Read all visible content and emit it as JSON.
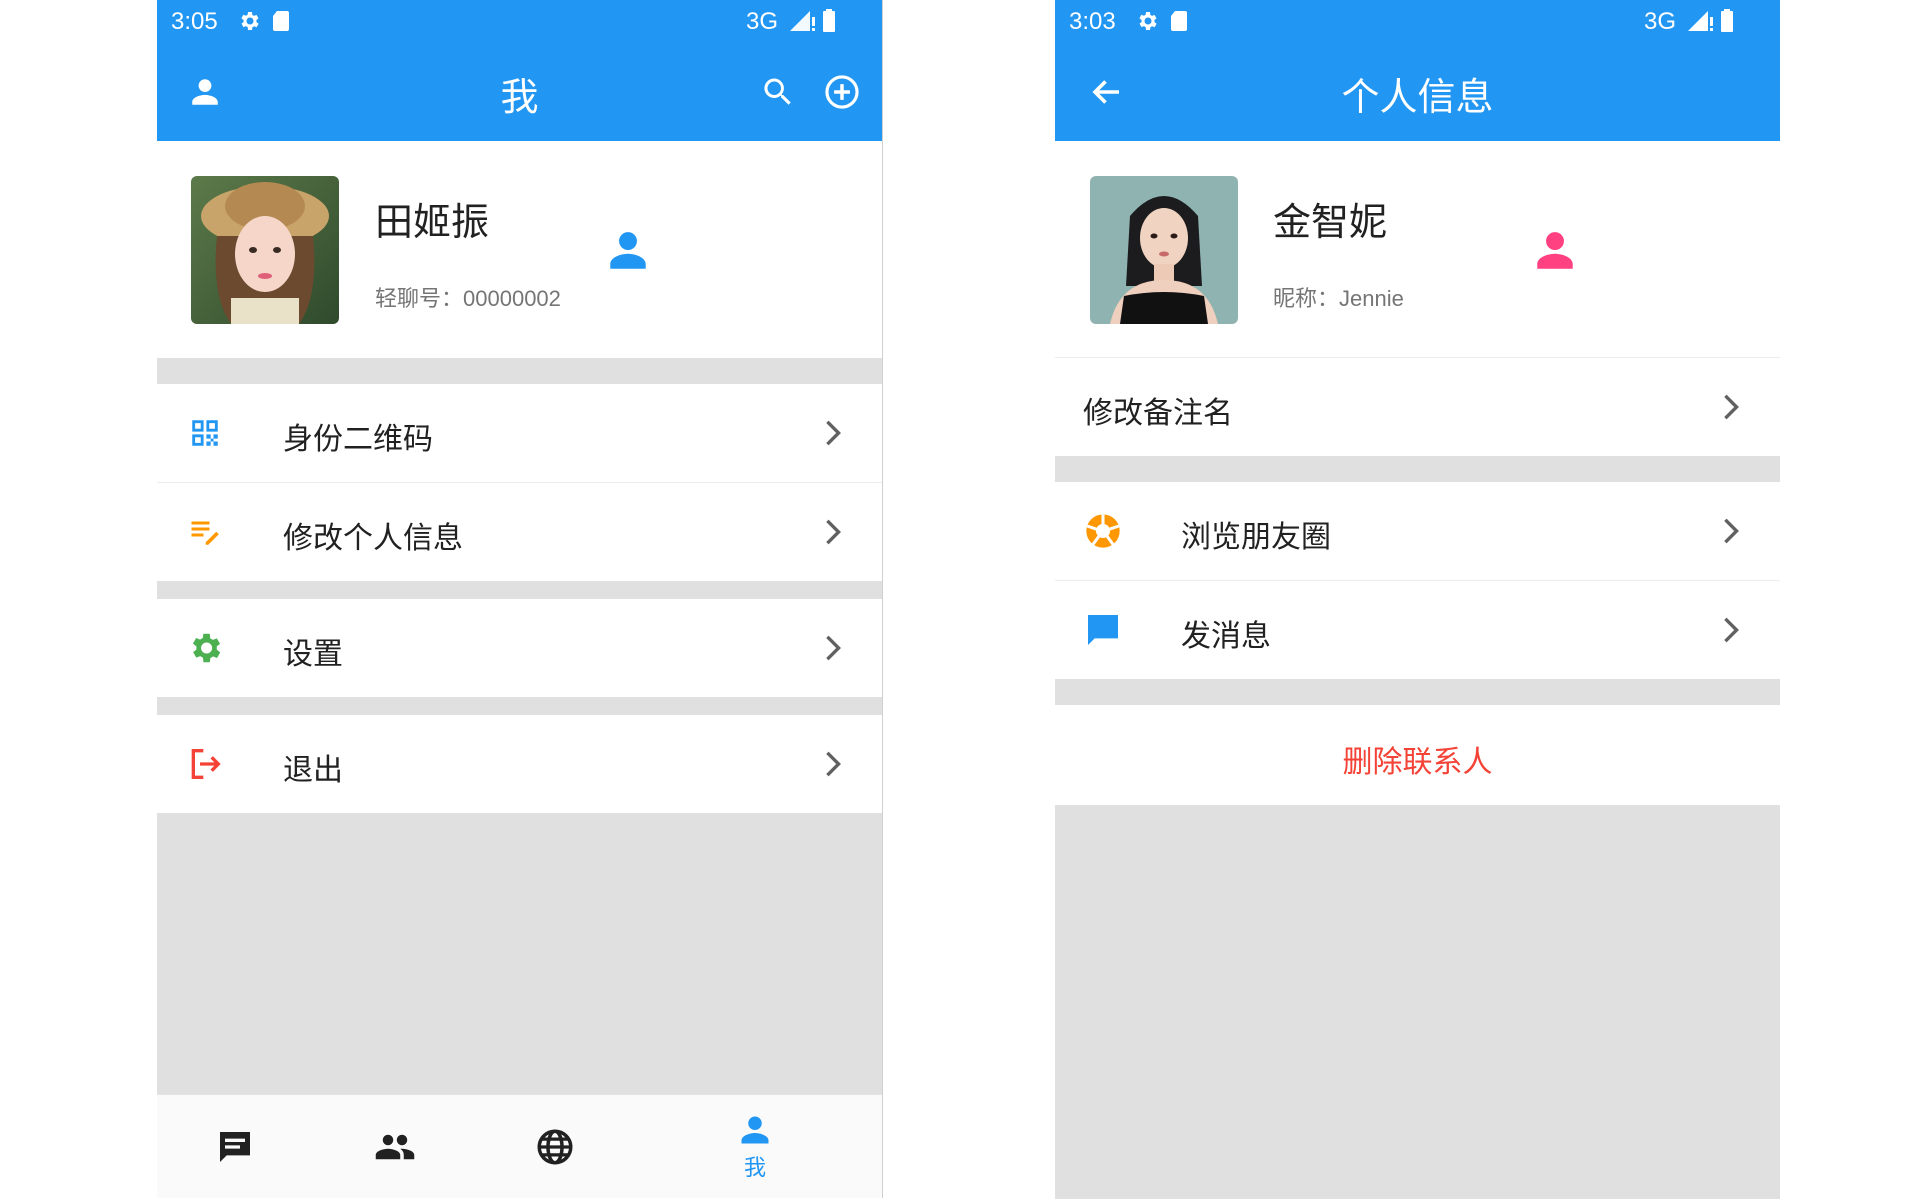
{
  "left": {
    "status": {
      "time": "3:05",
      "network": "3G"
    },
    "title": "我",
    "profile": {
      "name": "田姬振",
      "id_label": "轻聊号：",
      "id_value": "00000002"
    },
    "menu": [
      {
        "icon": "qr-code-icon",
        "label": "身份二维码",
        "color": "#2196f3"
      },
      {
        "icon": "edit-note-icon",
        "label": "修改个人信息",
        "color": "#ff9800"
      },
      {
        "icon": "settings-gear-icon",
        "label": "设置",
        "color": "#4caf50"
      },
      {
        "icon": "logout-icon",
        "label": "退出",
        "color": "#f44336"
      }
    ],
    "nav": {
      "items": [
        {
          "icon": "chat-icon"
        },
        {
          "icon": "contacts-icon"
        },
        {
          "icon": "globe-icon"
        },
        {
          "icon": "person-icon",
          "label": "我",
          "active": true
        }
      ]
    }
  },
  "right": {
    "status": {
      "time": "3:03",
      "network": "3G"
    },
    "title": "个人信息",
    "profile": {
      "name": "金智妮",
      "nick_label": "昵称：",
      "nick_value": "Jennie"
    },
    "rows": [
      {
        "label": "修改备注名"
      },
      {
        "icon": "moments-aperture-icon",
        "label": "浏览朋友圈",
        "color": "#ff9800"
      },
      {
        "icon": "message-bubble-icon",
        "label": "发消息",
        "color": "#2196f3"
      }
    ],
    "delete_label": "删除联系人",
    "delete_color": "#f44336"
  },
  "colors": {
    "primary": "#2196f3",
    "female_badge": "#ff4081",
    "male_badge": "#2196f3"
  }
}
